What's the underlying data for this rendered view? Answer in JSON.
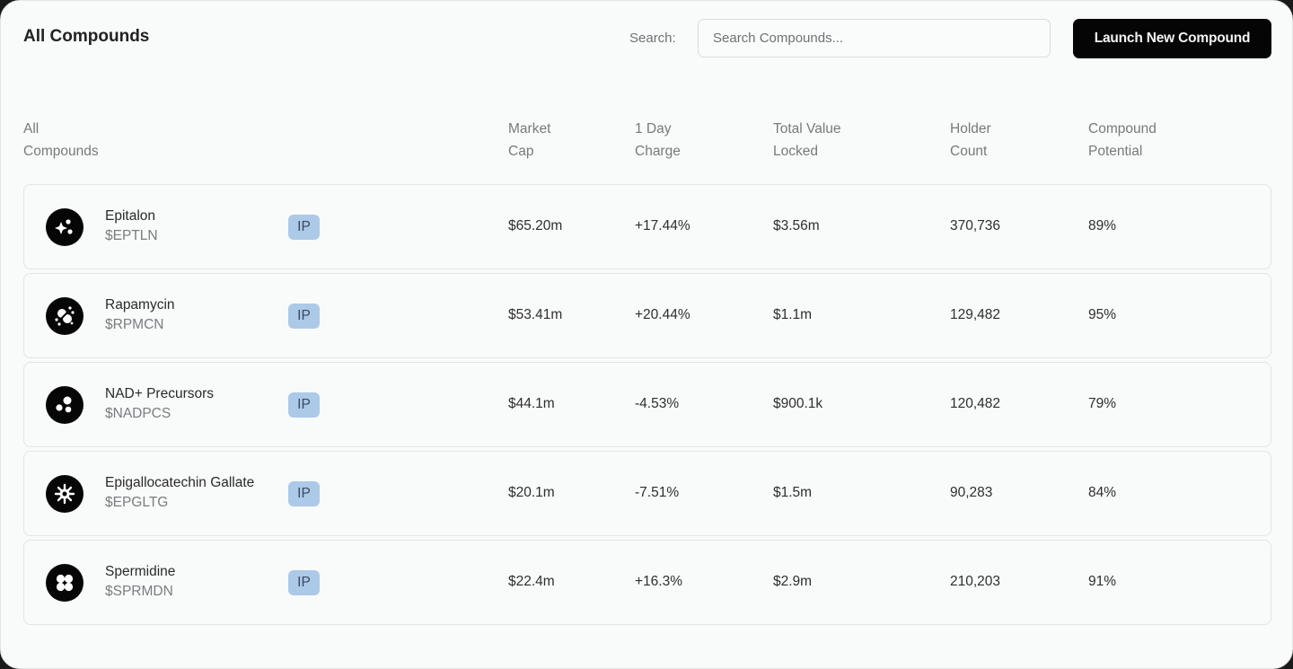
{
  "header": {
    "title": "All Compounds",
    "search_label": "Search:",
    "search_placeholder": "Search Compounds...",
    "search_value": "",
    "launch_button": "Launch New Compound"
  },
  "table": {
    "columns": [
      {
        "line1": "All",
        "line2": "Compounds"
      },
      {
        "line1": "Market",
        "line2": "Cap"
      },
      {
        "line1": "1 Day",
        "line2": "Charge"
      },
      {
        "line1": "Total Value",
        "line2": "Locked"
      },
      {
        "line1": "Holder",
        "line2": "Count"
      },
      {
        "line1": "Compound",
        "line2": "Potential"
      }
    ],
    "rows": [
      {
        "icon": "sparkles-icon",
        "name": "Epitalon",
        "ticker": "$EPTLN",
        "badge": "IP",
        "market_cap": "$65.20m",
        "day_change": "+17.44%",
        "tvl": "$3.56m",
        "holders": "370,736",
        "potential": "89%"
      },
      {
        "icon": "molecule-split-icon",
        "name": "Rapamycin",
        "ticker": "$RPMCN",
        "badge": "IP",
        "market_cap": "$53.41m",
        "day_change": "+20.44%",
        "tvl": "$1.1m",
        "holders": "129,482",
        "potential": "95%"
      },
      {
        "icon": "three-circles-icon",
        "name": "NAD+ Precursors",
        "ticker": "$NADPCS",
        "badge": "IP",
        "market_cap": "$44.1m",
        "day_change": "-4.53%",
        "tvl": "$900.1k",
        "holders": "120,482",
        "potential": "79%"
      },
      {
        "icon": "virus-gear-icon",
        "name": "Epigallocatechin Gallate",
        "ticker": "$EPGLTG",
        "badge": "IP",
        "market_cap": "$20.1m",
        "day_change": "-7.51%",
        "tvl": "$1.5m",
        "holders": "90,283",
        "potential": "84%"
      },
      {
        "icon": "four-dots-icon",
        "name": "Spermidine",
        "ticker": "$SPRMDN",
        "badge": "IP",
        "market_cap": "$22.4m",
        "day_change": "+16.3%",
        "tvl": "$2.9m",
        "holders": "210,203",
        "potential": "91%"
      }
    ]
  },
  "colors": {
    "button_bg": "#050505",
    "badge_bg": "#acc9e8",
    "panel_bg": "#f9fafa"
  }
}
